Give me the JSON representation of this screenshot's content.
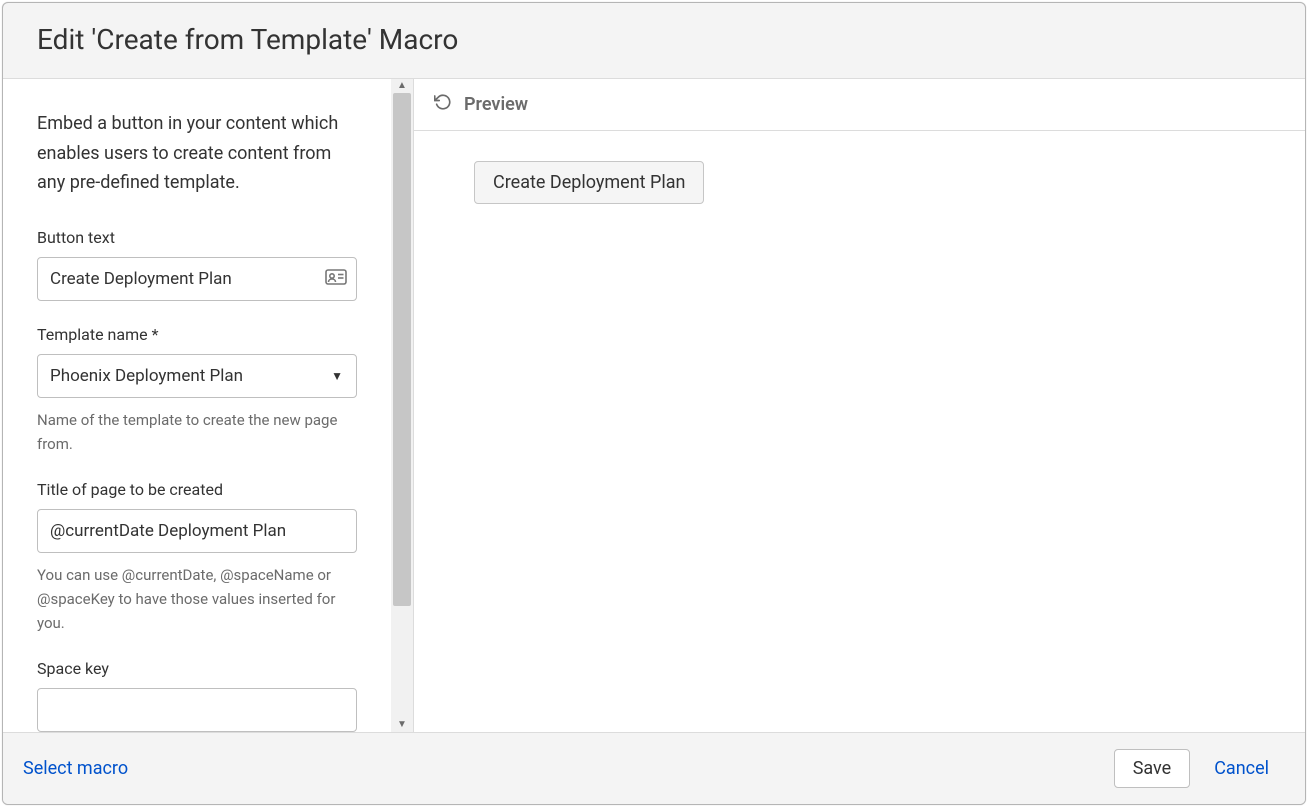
{
  "header": {
    "title": "Edit 'Create from Template' Macro"
  },
  "config": {
    "description": "Embed a button in your content which enables users to create content from any pre-defined template.",
    "fields": {
      "button_text": {
        "label": "Button text",
        "value": "Create Deployment Plan"
      },
      "template_name": {
        "label": "Template name *",
        "value": "Phoenix Deployment Plan",
        "help": "Name of the template to create the new page from."
      },
      "page_title": {
        "label": "Title of page to be created",
        "value": "@currentDate Deployment Plan",
        "help": "You can use @currentDate, @spaceName or @spaceKey to have those values inserted for you."
      },
      "space_key": {
        "label": "Space key",
        "value": ""
      }
    }
  },
  "preview": {
    "heading": "Preview",
    "button_label": "Create Deployment Plan"
  },
  "footer": {
    "select_macro": "Select macro",
    "save": "Save",
    "cancel": "Cancel"
  }
}
